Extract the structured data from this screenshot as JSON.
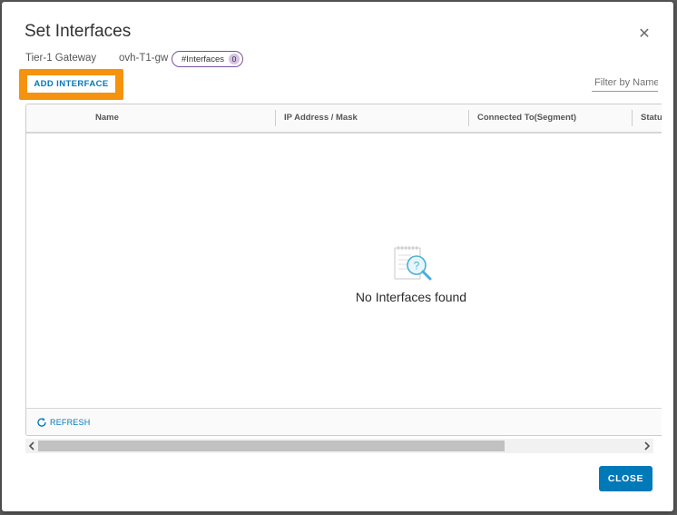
{
  "dialog": {
    "title": "Set Interfaces",
    "close_icon": "close-icon"
  },
  "meta": {
    "gateway_label": "Tier-1 Gateway",
    "gateway_value": "ovh-T1-gw",
    "badge_label": "#Interfaces",
    "badge_count": "0"
  },
  "toolbar": {
    "add_interface_label": "ADD INTERFACE",
    "filter_placeholder": "Filter by Name"
  },
  "grid": {
    "columns": [
      "Name",
      "IP Address / Mask",
      "Connected To(Segment)",
      "Status"
    ],
    "empty_text": "No Interfaces found",
    "empty_icon": "search-document-icon",
    "refresh_label": "REFRESH",
    "refresh_icon": "refresh-icon"
  },
  "scrollbar": {
    "left_icon": "chevron-left-icon",
    "right_icon": "chevron-right-icon"
  },
  "footer": {
    "close_label": "CLOSE"
  },
  "colors": {
    "primary": "#0079b8",
    "highlight": "#f5920e",
    "badge_border": "#7c539a"
  }
}
